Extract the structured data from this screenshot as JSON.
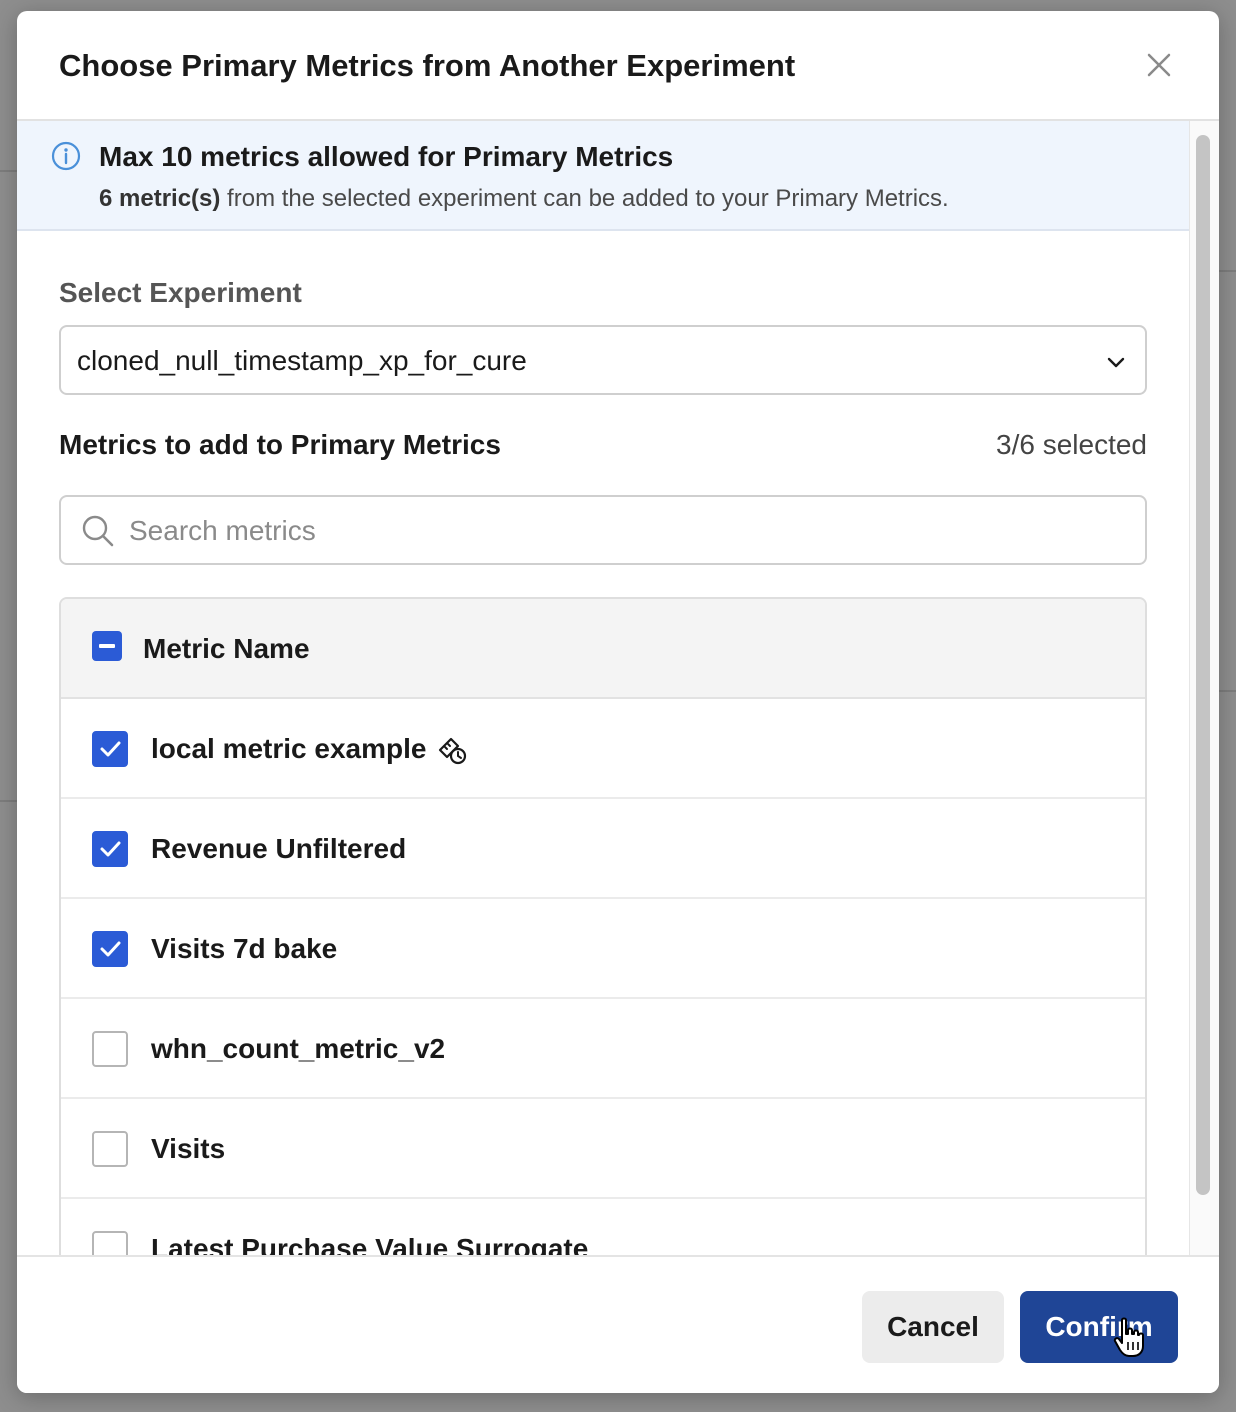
{
  "modal": {
    "title": "Choose Primary Metrics from Another Experiment"
  },
  "info": {
    "title": "Max 10 metrics allowed for Primary Metrics",
    "count_bold": "6 metric(s)",
    "description_rest": " from the selected experiment can be added to your Primary Metrics."
  },
  "select": {
    "label": "Select Experiment",
    "value": "cloned_null_timestamp_xp_for_cure"
  },
  "metrics": {
    "heading": "Metrics to add to Primary Metrics",
    "selected_count": "3/6 selected",
    "search_placeholder": "Search metrics",
    "column_header": "Metric Name",
    "rows": [
      {
        "label": "local metric example",
        "checked": true,
        "icon": "local-metric-icon"
      },
      {
        "label": "Revenue Unfiltered",
        "checked": true
      },
      {
        "label": "Visits 7d bake",
        "checked": true
      },
      {
        "label": "whn_count_metric_v2",
        "checked": false
      },
      {
        "label": "Visits",
        "checked": false
      },
      {
        "label": "Latest Purchase Value Surrogate",
        "checked": false
      }
    ]
  },
  "footer": {
    "cancel_label": "Cancel",
    "confirm_label": "Confirm"
  },
  "colors": {
    "primary": "#1f4596",
    "checkbox": "#2b5bd6",
    "info_bg": "#eff5fd",
    "info_icon": "#4a90d9"
  }
}
